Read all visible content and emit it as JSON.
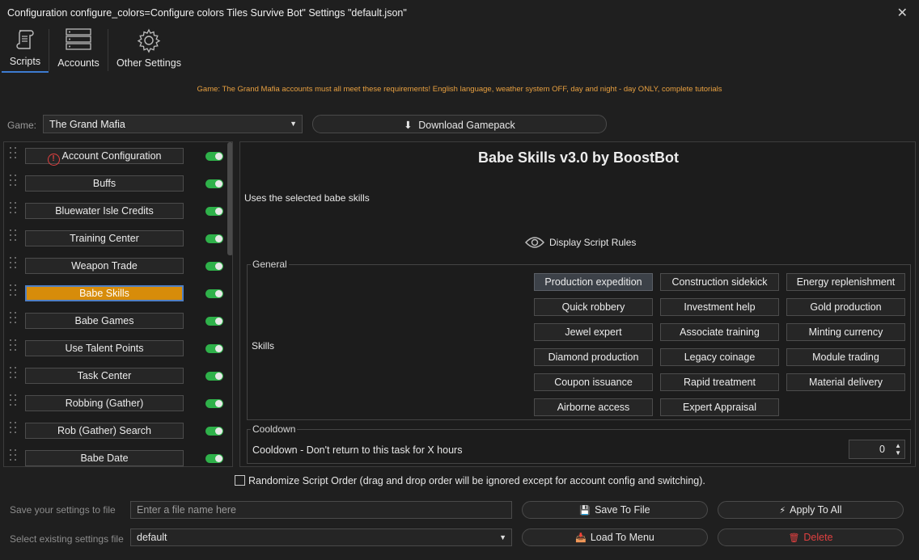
{
  "window": {
    "title": "Configuration configure_colors=Configure colors Tiles Survive Bot\" Settings \"default.json\"",
    "close_glyph": "✕"
  },
  "tabs": [
    {
      "label": "Scripts",
      "icon": "scroll-icon",
      "active": true
    },
    {
      "label": "Accounts",
      "icon": "server-icon",
      "active": false
    },
    {
      "label": "Other Settings",
      "icon": "gear-icon",
      "active": false
    }
  ],
  "notice": "Game: The Grand Mafia accounts must all meet these requirements! English language, weather system OFF, day and night - day ONLY, complete tutorials",
  "game": {
    "label": "Game:",
    "selected": "The Grand Mafia",
    "download_label": "Download Gamepack"
  },
  "scripts": [
    {
      "label": "Account Configuration",
      "warning": true,
      "enabled": true,
      "selected": false
    },
    {
      "label": "Buffs",
      "enabled": true,
      "selected": false
    },
    {
      "label": "Bluewater Isle Credits",
      "enabled": true,
      "selected": false
    },
    {
      "label": "Training Center",
      "enabled": true,
      "selected": false
    },
    {
      "label": "Weapon Trade",
      "enabled": true,
      "selected": false
    },
    {
      "label": "Babe Skills",
      "enabled": true,
      "selected": true
    },
    {
      "label": "Babe Games",
      "enabled": true,
      "selected": false
    },
    {
      "label": "Use Talent Points",
      "enabled": true,
      "selected": false
    },
    {
      "label": "Task Center",
      "enabled": true,
      "selected": false
    },
    {
      "label": "Robbing (Gather)",
      "enabled": true,
      "selected": false
    },
    {
      "label": "Rob (Gather) Search",
      "enabled": true,
      "selected": false
    },
    {
      "label": "Babe Date",
      "enabled": true,
      "selected": false
    }
  ],
  "detail": {
    "title": "Babe Skills v3.0 by BoostBot",
    "description": "Uses the selected babe skills",
    "rules_link": "Display Script Rules",
    "general_title": "General",
    "skills_label": "Skills",
    "skills": [
      {
        "label": "Production expedition",
        "on": true
      },
      {
        "label": "Construction sidekick",
        "on": false
      },
      {
        "label": "Energy replenishment",
        "on": false
      },
      {
        "label": "Quick robbery",
        "on": false
      },
      {
        "label": "Investment help",
        "on": false
      },
      {
        "label": "Gold production",
        "on": false
      },
      {
        "label": "Jewel expert",
        "on": false
      },
      {
        "label": "Associate training",
        "on": false
      },
      {
        "label": "Minting currency",
        "on": false
      },
      {
        "label": "Diamond production",
        "on": false
      },
      {
        "label": "Legacy coinage",
        "on": false
      },
      {
        "label": "Module trading",
        "on": false
      },
      {
        "label": "Coupon issuance",
        "on": false
      },
      {
        "label": "Rapid treatment",
        "on": false
      },
      {
        "label": "Material delivery",
        "on": false
      },
      {
        "label": "Airborne access",
        "on": false
      },
      {
        "label": "Expert Appraisal",
        "on": false
      }
    ],
    "cooldown_title": "Cooldown",
    "cooldown_label": "Cooldown - Don't return to this task for X hours",
    "cooldown_value": "0"
  },
  "randomize_label": "Randomize Script Order (drag and drop order will be ignored except for account config and switching).",
  "save": {
    "label": "Save your settings to file",
    "placeholder": "Enter a file name here",
    "button": "Save To File",
    "apply_all": "Apply To All"
  },
  "load": {
    "label": "Select existing settings file",
    "selected": "default",
    "button": "Load To Menu",
    "delete": "Delete"
  },
  "colors": {
    "accent": "#d78c0a",
    "toggle_on": "#2fb14a",
    "notice": "#e8a040",
    "delete": "#e04040",
    "save_icon": "#e0a020"
  }
}
